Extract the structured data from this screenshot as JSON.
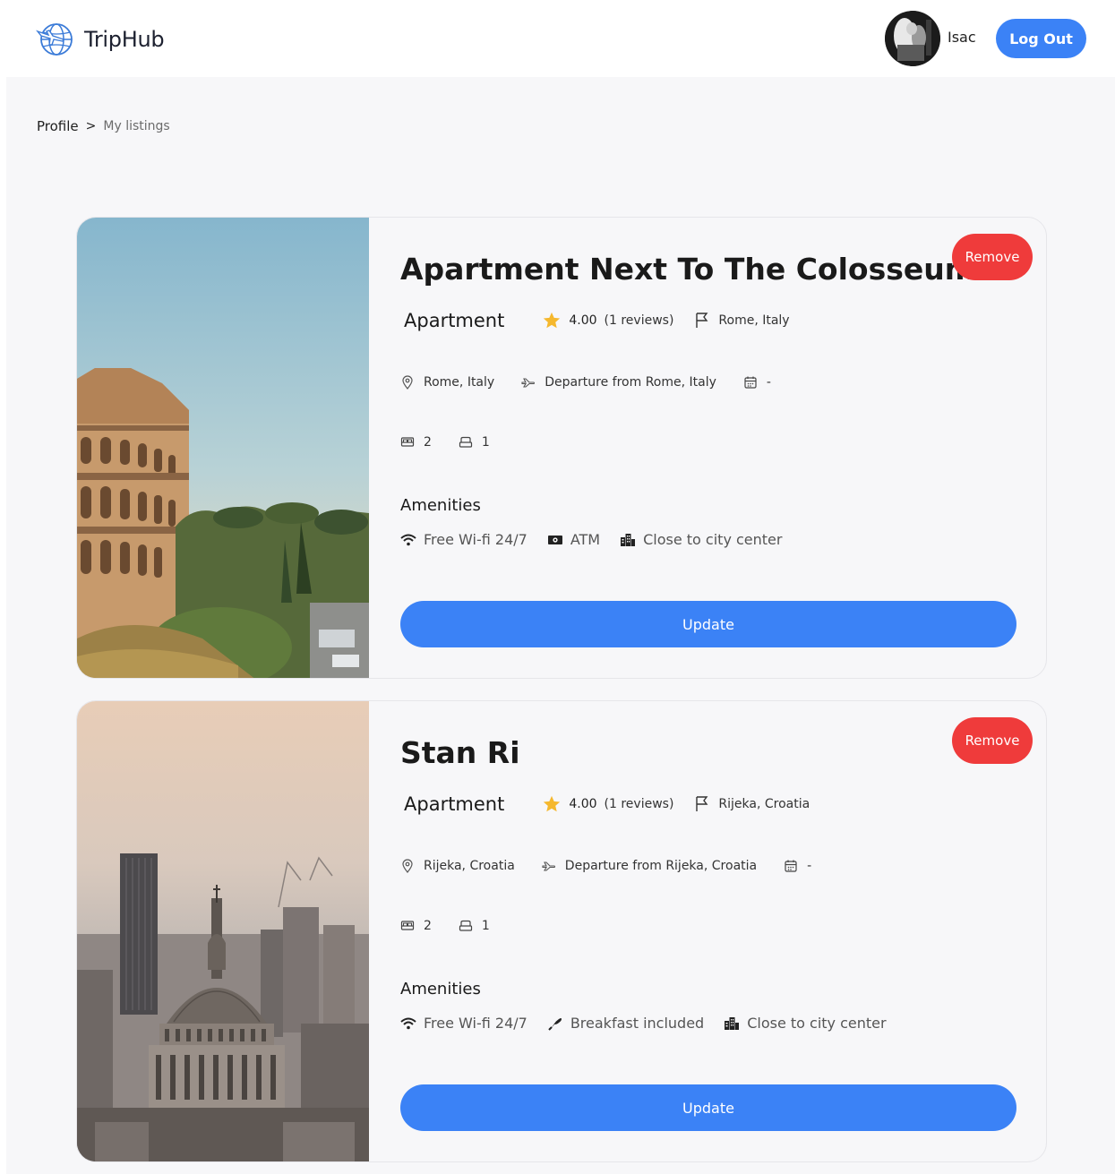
{
  "header": {
    "brand": "TripHub",
    "user_name": "Isac",
    "logout_label": "Log Out",
    "accent_color": "#3b82f6"
  },
  "breadcrumb": {
    "items": [
      "Profile",
      ">",
      "My listings"
    ]
  },
  "listings": [
    {
      "title": "Apartment Next To The Colosseum",
      "remove_label": "Remove",
      "type": "Apartment",
      "rating": "4.00",
      "reviews": "(1 reviews)",
      "flag_location": "Rome, Italy",
      "location": "Rome, Italy",
      "departure": "Departure from Rome, Italy",
      "date": "-",
      "beds": "2",
      "baths": "1",
      "amenities_title": "Amenities",
      "amenities": [
        {
          "icon": "wifi-icon",
          "label": "Free Wi-fi 24/7"
        },
        {
          "icon": "atm-icon",
          "label": "ATM"
        },
        {
          "icon": "city-icon",
          "label": "Close to city center"
        }
      ],
      "update_label": "Update"
    },
    {
      "title": "Stan Ri",
      "remove_label": "Remove",
      "type": "Apartment",
      "rating": "4.00",
      "reviews": "(1 reviews)",
      "flag_location": "Rijeka, Croatia",
      "location": "Rijeka, Croatia",
      "departure": "Departure from Rijeka, Croatia",
      "date": "-",
      "beds": "2",
      "baths": "1",
      "amenities_title": "Amenities",
      "amenities": [
        {
          "icon": "wifi-icon",
          "label": "Free Wi-fi 24/7"
        },
        {
          "icon": "breakfast-icon",
          "label": "Breakfast included"
        },
        {
          "icon": "city-icon",
          "label": "Close to city center"
        }
      ],
      "update_label": "Update"
    }
  ],
  "colors": {
    "remove": "#ef3b3b",
    "update": "#3b82f6",
    "star": "#f5b82e"
  }
}
